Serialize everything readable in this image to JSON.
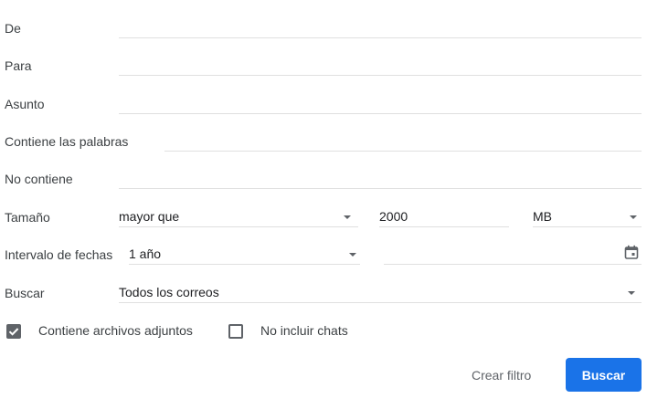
{
  "form": {
    "from": {
      "label": "De",
      "value": ""
    },
    "to": {
      "label": "Para",
      "value": ""
    },
    "subject": {
      "label": "Asunto",
      "value": ""
    },
    "has_words": {
      "label": "Contiene las palabras",
      "value": ""
    },
    "doesnt_have": {
      "label": "No contiene",
      "value": ""
    },
    "size": {
      "label": "Tamaño",
      "operator": "mayor que",
      "amount": "2000",
      "unit": "MB"
    },
    "date_within": {
      "label": "Intervalo de fechas",
      "range": "1 año",
      "date": ""
    },
    "search": {
      "label": "Buscar",
      "scope": "Todos los correos"
    },
    "has_attachment": {
      "label": "Contiene archivos adjuntos",
      "checked": true
    },
    "exclude_chats": {
      "label": "No incluir chats",
      "checked": false
    }
  },
  "actions": {
    "create_filter": "Crear filtro",
    "search": "Buscar"
  },
  "colors": {
    "primary": "#1a73e8",
    "text": "#3c4043",
    "divider": "#e0e0e0",
    "icon": "#5f6368"
  }
}
